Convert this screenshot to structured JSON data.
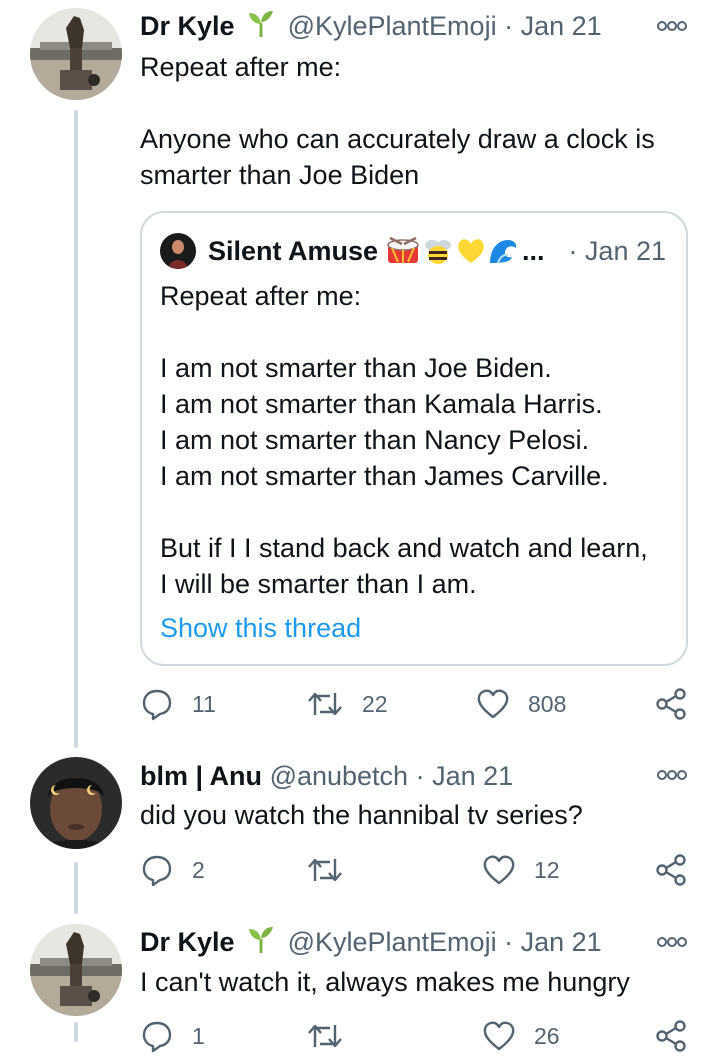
{
  "tweets": [
    {
      "name": "Dr Kyle",
      "handle": "@KylePlantEmoji",
      "sep": "·",
      "date": "Jan 21",
      "text": "Repeat after me:\n\nAnyone who can accurately draw a clock is smarter than Joe Biden",
      "quote": {
        "name": "Silent Amuse",
        "ellipsis": "...",
        "sep": "·",
        "date": "Jan 21",
        "text": "Repeat after me:\n\nI am not smarter than Joe Biden.\nI am not smarter than Kamala Harris.\nI am not smarter than Nancy Pelosi.\nI am not smarter than James Carville.\n\nBut if I I stand back and watch and learn,\nI will be smarter than I am.",
        "link": "Show this thread",
        "emojis": [
          "drum-emoji",
          "bee-emoji",
          "yellow-heart-emoji",
          "wave-emoji"
        ]
      },
      "replies": "11",
      "retweets": "22",
      "likes": "808"
    },
    {
      "name": "blm | Anu",
      "handle": "@anubetch",
      "sep": "·",
      "date": "Jan 21",
      "text": "did you watch the hannibal tv series?",
      "replies": "2",
      "retweets": "",
      "likes": "12"
    },
    {
      "name": "Dr Kyle",
      "handle": "@KylePlantEmoji",
      "sep": "·",
      "date": "Jan 21",
      "text": "I can't watch it, always makes me hungry",
      "replies": "1",
      "retweets": "",
      "likes": "26"
    }
  ],
  "colors": {
    "text": "#0f1419",
    "secondary": "#536471",
    "link": "#1d9bf0",
    "border": "#cfd9de",
    "plant": "#7cb342"
  },
  "icons": {
    "reply": "reply-icon",
    "retweet": "retweet-icon",
    "like": "heart-icon",
    "share": "share-icon",
    "more": "more-options-icon",
    "verified_plant": "seedling-emoji"
  }
}
